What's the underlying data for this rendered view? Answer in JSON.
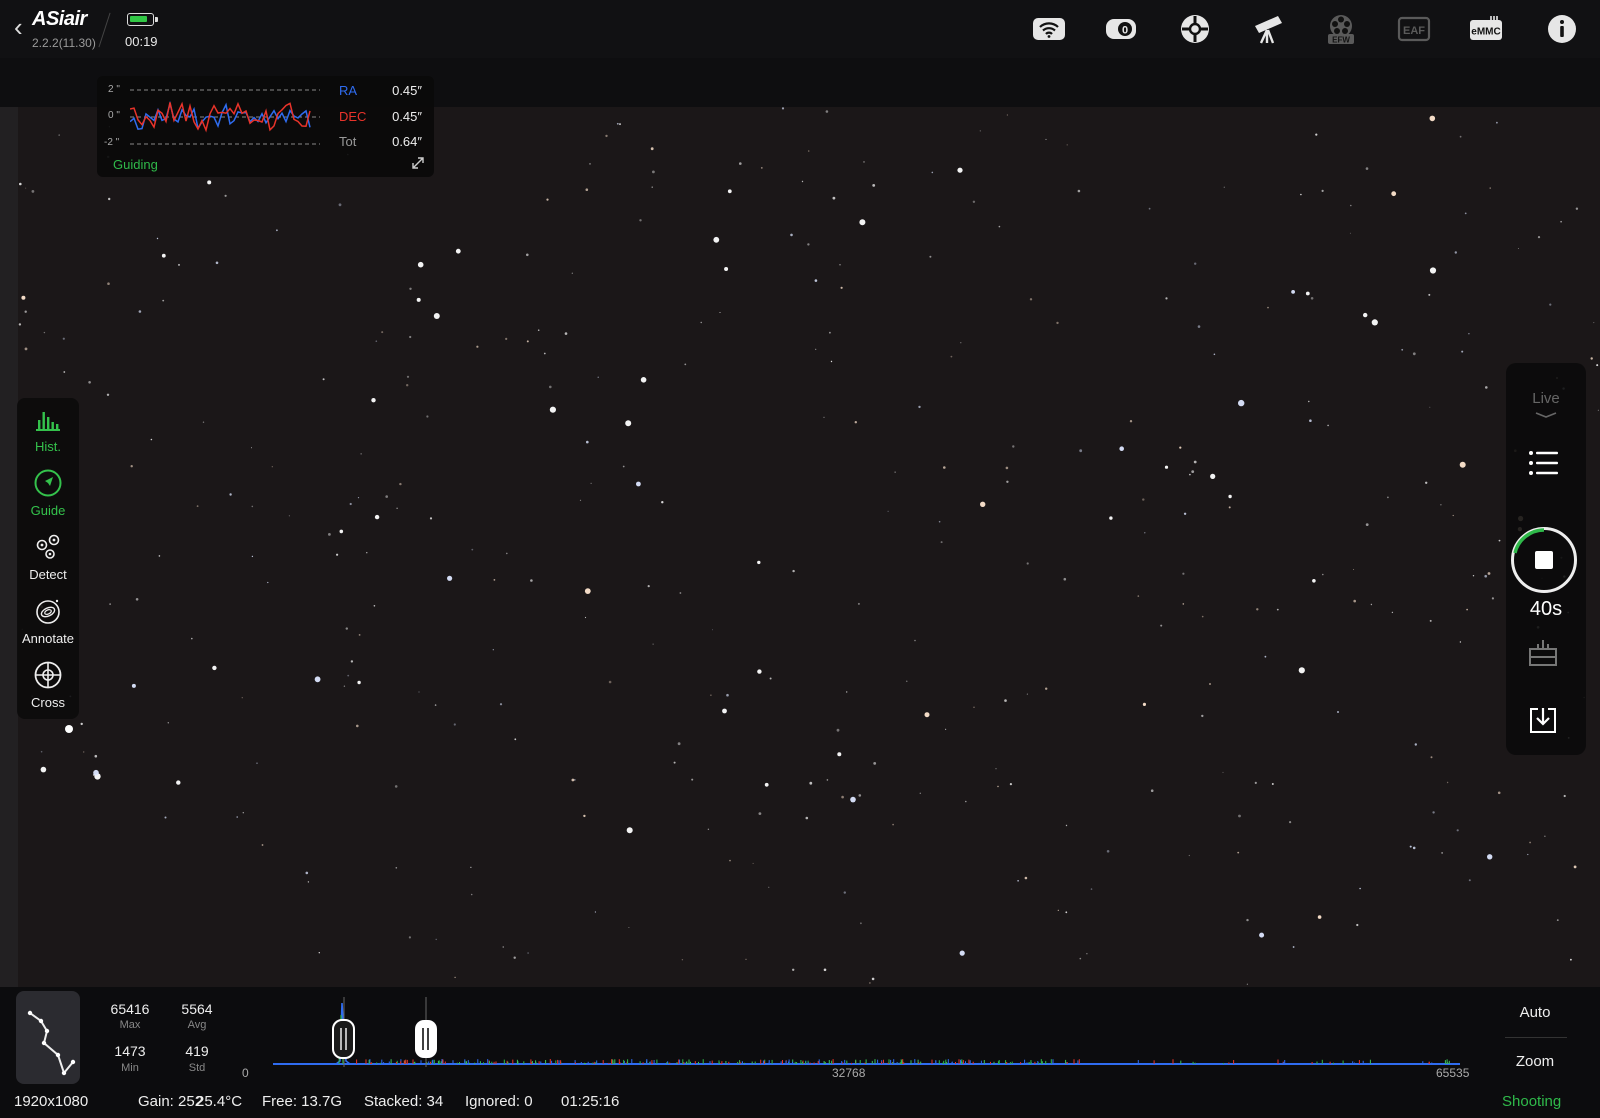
{
  "header": {
    "logo": "ASiair",
    "version": "2.2.2(11.30)",
    "clock": "00:19",
    "icons": [
      "wifi-icon",
      "camera-icon",
      "guide-scope-icon",
      "telescope-mount-icon",
      "efw-icon",
      "eaf-icon",
      "emmc-icon",
      "info-icon"
    ],
    "efw_label": "EFW",
    "eaf_label": "EAF",
    "emmc_label": "eMMC"
  },
  "guiding": {
    "y_ticks": [
      "2 \"",
      "0 \"",
      "-2 \""
    ],
    "ra_label": "RA",
    "ra_value": "0.45″",
    "dec_label": "DEC",
    "dec_value": "0.45″",
    "tot_label": "Tot",
    "tot_value": "0.64″",
    "status": "Guiding",
    "ra_color": "#2f6cf0",
    "dec_color": "#e8332a"
  },
  "left_tools": [
    {
      "label": "Hist.",
      "icon": "histogram-icon",
      "active": true
    },
    {
      "label": "Guide",
      "icon": "guide-arrow-icon",
      "active": true
    },
    {
      "label": "Detect",
      "icon": "detect-stars-icon",
      "active": false
    },
    {
      "label": "Annotate",
      "icon": "annotate-galaxy-icon",
      "active": false
    },
    {
      "label": "Cross",
      "icon": "crosshair-icon",
      "active": false
    }
  ],
  "right_panel": {
    "mode": "Live",
    "exposure": "40s"
  },
  "histogram": {
    "max": "65416",
    "max_label": "Max",
    "avg": "5564",
    "avg_label": "Avg",
    "min": "1473",
    "min_label": "Min",
    "std": "419",
    "std_label": "Std",
    "axis_min": "0",
    "axis_mid": "32768",
    "axis_max": "65535",
    "auto_label": "Auto",
    "zoom_label": "Zoom"
  },
  "status_bar": {
    "resolution": "1920x1080",
    "gain": "Gain: 252",
    "temperature": "25.4°C",
    "free": "Free: 13.7G",
    "stacked": "Stacked: 34",
    "ignored": "Ignored: 0",
    "elapsed": "01:25:16",
    "state": "Shooting"
  },
  "colors": {
    "accent_green": "#2fb94a",
    "background_sky": "#1b1718"
  }
}
